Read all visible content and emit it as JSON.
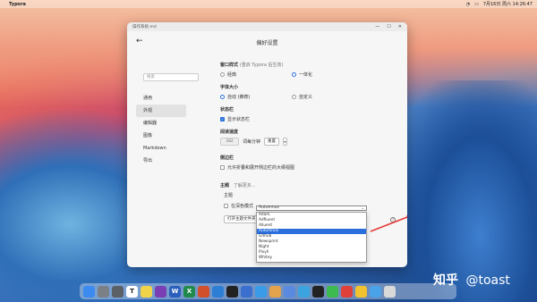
{
  "menubar": {
    "app_name": "Typora",
    "clock": "7月16日 周六 14:26:47"
  },
  "window": {
    "title": "操作系统.md",
    "header": "偏好设置"
  },
  "sidebar": {
    "search_placeholder": "搜索",
    "items": [
      {
        "label": "通用"
      },
      {
        "label": "外观"
      },
      {
        "label": "编辑器"
      },
      {
        "label": "图像"
      },
      {
        "label": "Markdown"
      },
      {
        "label": "导出"
      }
    ]
  },
  "settings": {
    "window_style": {
      "label": "窗口样式",
      "note": "(重启 Typora 后生效)",
      "opt1": "经典",
      "opt2": "一体化"
    },
    "font_size": {
      "label": "字体大小",
      "opt1": "自动 (推荐)",
      "opt2": "自定义"
    },
    "status_bar": {
      "label": "状态栏",
      "checkbox": "显示状态栏"
    },
    "reading_speed": {
      "label": "阅读速度",
      "value": "382",
      "unit": "词每分钟",
      "reset": "重置",
      "dropdown": "▾"
    },
    "sidebar_section": {
      "label": "侧边栏",
      "checkbox": "允许折叠和展开侧边栏的大纲视图"
    },
    "theme": {
      "label": "主题",
      "link": "了解更多...",
      "row_label": "主题",
      "current": "Autumnus",
      "checkbox": "在深色模式",
      "open_button": "打开主题文件夹",
      "help": "?",
      "options": [
        "Adark",
        "Adfluent",
        "Alluent",
        "Autumnus",
        "Github",
        "Newsprint",
        "Night",
        "Pixyll",
        "Whitey"
      ],
      "selected": "Autumnus"
    }
  },
  "watermark": {
    "logo": "知乎",
    "handle": "@toast"
  },
  "dock": {
    "icons": [
      {
        "name": "finder-icon",
        "color": "#3d8bf0",
        "glyph": ""
      },
      {
        "name": "launchpad-icon",
        "color": "#7b7f86",
        "glyph": ""
      },
      {
        "name": "settings-icon",
        "color": "#5b5f66",
        "glyph": ""
      },
      {
        "name": "typora-icon",
        "color": "#ffffff",
        "glyph": "T"
      },
      {
        "name": "notes-icon",
        "color": "#f1d34a",
        "glyph": ""
      },
      {
        "name": "onenote-icon",
        "color": "#7a3fb4",
        "glyph": ""
      },
      {
        "name": "word-icon",
        "color": "#2b5fbd",
        "glyph": "W"
      },
      {
        "name": "excel-icon",
        "color": "#1f8a4c",
        "glyph": "X"
      },
      {
        "name": "powerpoint-icon",
        "color": "#d2502b",
        "glyph": ""
      },
      {
        "name": "vscode-icon",
        "color": "#2d7fd6",
        "glyph": ""
      },
      {
        "name": "terminal-icon",
        "color": "#222222",
        "glyph": ""
      },
      {
        "name": "app-icon",
        "color": "#3a6fd0",
        "glyph": ""
      },
      {
        "name": "safari-icon",
        "color": "#3a9be8",
        "glyph": ""
      },
      {
        "name": "photos-icon",
        "color": "#e3a24c",
        "glyph": ""
      },
      {
        "name": "app2-icon",
        "color": "#5a8ae0",
        "glyph": ""
      },
      {
        "name": "app3-icon",
        "color": "#3aa3e0",
        "glyph": ""
      },
      {
        "name": "qq-icon",
        "color": "#222222",
        "glyph": ""
      },
      {
        "name": "wechat-icon",
        "color": "#3dbb4e",
        "glyph": ""
      },
      {
        "name": "music-icon",
        "color": "#e0403a",
        "glyph": ""
      },
      {
        "name": "app4-icon",
        "color": "#f2c230",
        "glyph": ""
      },
      {
        "name": "downloads-icon",
        "color": "#4aa2e8",
        "glyph": ""
      },
      {
        "name": "trash-icon",
        "color": "#d9d9d9",
        "glyph": ""
      }
    ]
  }
}
